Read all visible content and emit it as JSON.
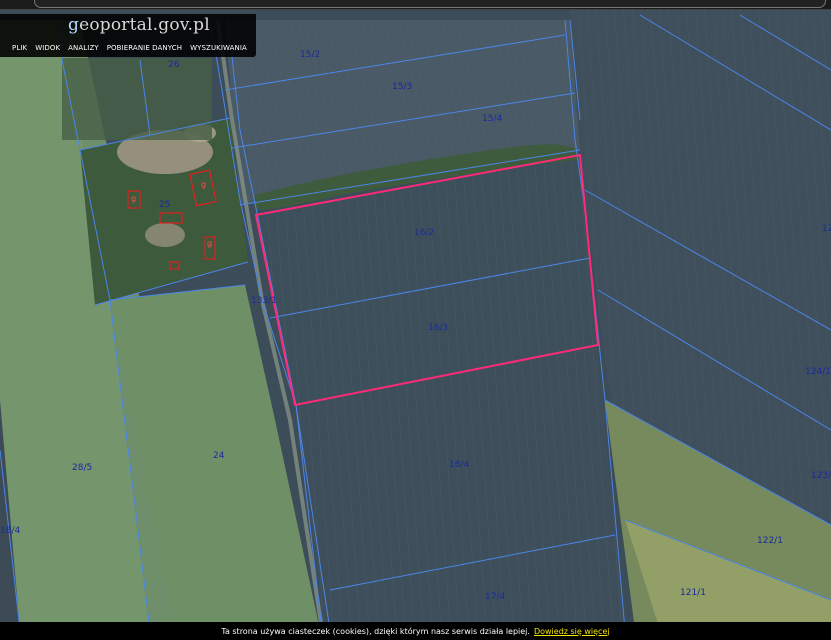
{
  "browser": {
    "url": ""
  },
  "toolbar": {
    "logo_prefix": "g",
    "logo_text": "eoportal.gov.pl",
    "menu": [
      "PLIK",
      "WIDOK",
      "ANALIZY",
      "POBIERANIE DANYCH",
      "WYSZUKIWANIA"
    ]
  },
  "map": {
    "parcel_labels": [
      "15/2",
      "26",
      "15/3",
      "15/4",
      "25",
      "16/2",
      "133/1",
      "16/3",
      "124/1",
      "24",
      "16/4",
      "28/5",
      "123/1",
      "18/4",
      "122/1",
      "17/4",
      "121/1",
      "12"
    ],
    "building_labels": [
      "g",
      "g",
      "g"
    ],
    "colors": {
      "parcel_boundary": "#4a86e8",
      "selected_parcel": "#ff2a77",
      "building_outline": "#e02020",
      "label": "#1a2a9a"
    }
  },
  "cookie": {
    "text": "Ta strona używa ciasteczek (cookies), dzięki którym nasz serwis działa lepiej.",
    "link": "Dowiedz się więcej"
  }
}
